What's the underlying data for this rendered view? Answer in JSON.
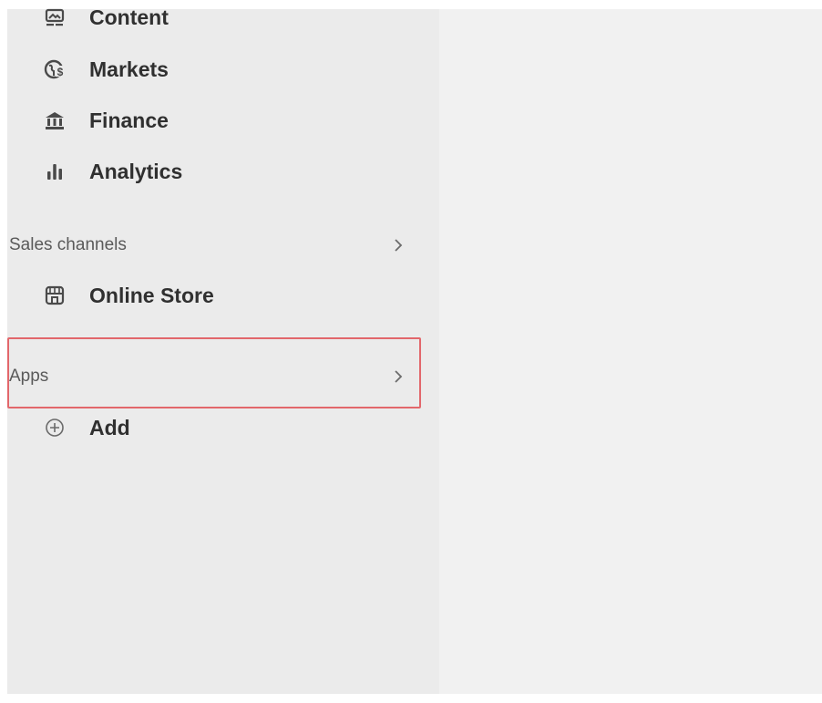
{
  "sidebar": {
    "items": [
      {
        "label": "Content",
        "icon": "content-icon"
      },
      {
        "label": "Markets",
        "icon": "globe-dollar-icon"
      },
      {
        "label": "Finance",
        "icon": "bank-icon"
      },
      {
        "label": "Analytics",
        "icon": "bar-chart-icon"
      }
    ],
    "sales_channels": {
      "label": "Sales channels",
      "items": [
        {
          "label": "Online Store",
          "icon": "store-icon"
        }
      ]
    },
    "apps": {
      "label": "Apps",
      "add_label": "Add"
    }
  },
  "colors": {
    "sidebar_bg": "#ebebeb",
    "main_bg": "#f1f1f1",
    "highlight_border": "#e2676b",
    "text": "#303030",
    "muted_text": "#5a5a5a"
  }
}
